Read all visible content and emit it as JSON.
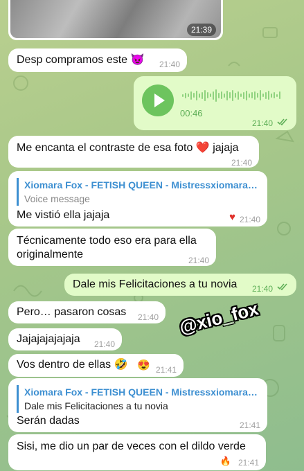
{
  "media": {
    "time": "21:39"
  },
  "messages": [
    {
      "text": "Desp compramos este 😈",
      "time": "21:40"
    },
    {
      "voice_duration": "00:46",
      "time": "21:40"
    },
    {
      "text": "Me encanta el contraste de esa foto",
      "emoji": "❤️",
      "text_after": "jajaja",
      "time": "21:40"
    },
    {
      "reply_name": "Xiomara Fox - FETISH QUEEN - Mistressxiomaraf…",
      "reply_text": "Voice message",
      "text": "Me vistió ella jajaja",
      "reaction": "♥",
      "time": "21:40"
    },
    {
      "text_line1": "Técnicamente todo eso era para ella",
      "text_line2": "originalmente",
      "time": "21:40"
    },
    {
      "text": "Dale mis Felicitaciones a tu novia",
      "time": "21:40"
    },
    {
      "text": "Pero… pasaron cosas",
      "time": "21:40"
    },
    {
      "text": "Jajajajajajaja",
      "time": "21:40"
    },
    {
      "text": "Vos dentro de ellas 🤣",
      "reaction": "😍",
      "time": "21:41"
    },
    {
      "reply_name": "Xiomara Fox - FETISH QUEEN - Mistressxiomaraf…",
      "reply_text": "Dale mis Felicitaciones a tu novia",
      "text": "Serán dadas",
      "time": "21:41"
    },
    {
      "text": "Sisi, me dio un par de veces con el dildo verde",
      "reaction": "🔥",
      "time": "21:41"
    }
  ],
  "watermark": "@xio_fox",
  "colors": {
    "accent_green": "#6dc45e",
    "link_blue": "#3d8fd1",
    "outgoing_bubble": "#e2fbc8"
  }
}
